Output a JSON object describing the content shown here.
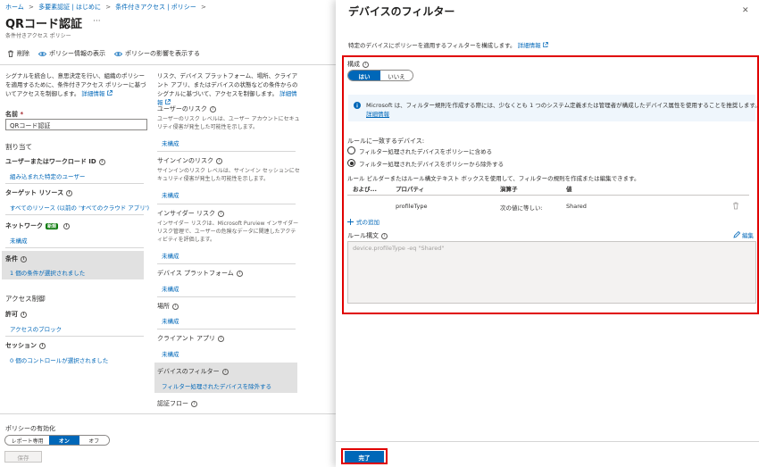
{
  "breadcrumb": [
    "ホーム",
    "多要素認証 | はじめに",
    "条件付きアクセス | ポリシー"
  ],
  "breadcrumb_separator": ">",
  "page": {
    "title": "QRコード認証",
    "more": "···",
    "subtitle": "条件付きアクセス ポリシー"
  },
  "toolbar": {
    "delete": "削除",
    "view_info": "ポリシー情報の表示",
    "view_impact": "ポリシーの影響を表示する"
  },
  "left_col": {
    "intro": "シグナルを統合し、意思決定を行い、組織のポリシーを適用するために、条件付きアクセス ポリシーに基づいてアクセスを制御します。",
    "learn_more": "詳細情報",
    "name_label": "名前",
    "name_required": "*",
    "name_value": "QRコード認証",
    "assignments": "割り当て",
    "users_label": "ユーザーまたはワークロード ID",
    "users_value": "組み込まれた特定のユーザー",
    "target_label": "ターゲット リソース",
    "target_value": "すべてのリソース (以前の 'すべてのクラウド アプリ')",
    "network_label": "ネットワーク",
    "network_badge": "新規",
    "network_value": "未構成",
    "conditions_label": "条件",
    "conditions_value": "1 個の条件が選択されました",
    "access_controls": "アクセス制御",
    "grant_label": "許可",
    "grant_value": "アクセスのブロック",
    "session_label": "セッション",
    "session_value": "0 個のコントロールが選択されました"
  },
  "mid_col": {
    "intro": "リスク、デバイス プラットフォーム、場所、クライアント アプリ、またはデバイスの状態などの条件からのシグナルに基づいて、アクセスを制御します。",
    "learn_more": "詳細情報",
    "user_risk_label": "ユーザーのリスク",
    "user_risk_desc": "ユーザーのリスク レベルは、ユーザー アカウントにセキュリティ侵害が発生した可能性を示します。",
    "user_risk_value": "未構成",
    "signin_risk_label": "サインインのリスク",
    "signin_risk_desc": "サインインのリスク レベルは、サインイン セッションにセキュリティ侵害が発生した可能性を示します。",
    "signin_risk_value": "未構成",
    "insider_label": "インサイダー リスク",
    "insider_desc": "インサイダー リスクは、Microsoft Purview インサイダー リスク管理で、ユーザーの危険なデータに関連したアクティビティを評価します。",
    "insider_value": "未構成",
    "platform_label": "デバイス プラットフォーム",
    "platform_value": "未構成",
    "location_label": "場所",
    "location_value": "未構成",
    "client_label": "クライアント アプリ",
    "client_value": "未構成",
    "filter_label": "デバイスのフィルター",
    "filter_value": "フィルター処理されたデバイスを除外する",
    "auth_flow_label": "認証フロー"
  },
  "footer": {
    "enable_label": "ポリシーの有効化",
    "opt_report": "レポート専用",
    "opt_on": "オン",
    "opt_off": "オフ",
    "save": "保存"
  },
  "flyout": {
    "title": "デバイスのフィルター",
    "close": "✕",
    "intro": "特定のデバイスにポリシーを適用するフィルターを構成します。",
    "learn_more": "詳細情報",
    "configure_label": "構成",
    "yes": "はい",
    "no": "いいえ",
    "notice": "Microsoft は、フィルター規則を作成する際には、少なくとも 1 つのシステム定義または管理者が構成したデバイス属性を使用することを推奨します。",
    "notice_link": "詳細情報",
    "matching_label": "ルールに一致するデバイス:",
    "opt_include": "フィルター処理されたデバイスをポリシーに含める",
    "opt_exclude": "フィルター処理されたデバイスをポリシーから除外する",
    "builder_desc": "ルール ビルダーまたはルール構文テキスト ボックスを使用して、フィルターの規則を作成または編集できます。",
    "table_headers": [
      "および...",
      "プロパティ",
      "演算子",
      "値"
    ],
    "table_row": {
      "property": "profileType",
      "operator": "次の値に等しい:",
      "value": "Shared"
    },
    "add_expression": "式の追加",
    "syntax_label": "ルール構文",
    "edit": "編集",
    "syntax_value": "device.profileType -eq \"Shared\"",
    "done": "完了"
  },
  "colors": {
    "accent": "#0067b8",
    "highlight_border": "#e00000",
    "selected_bg": "#e1e1e1",
    "notice_bg": "#eff6fc"
  },
  "icons": [
    "trash-icon",
    "eye-icon",
    "info-icon",
    "plus-icon",
    "pencil-icon",
    "close-icon",
    "external-link-icon"
  ]
}
